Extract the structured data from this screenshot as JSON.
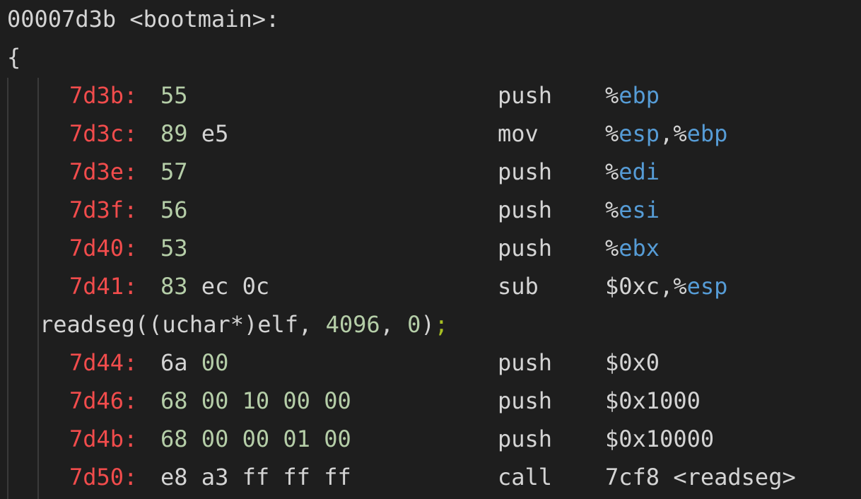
{
  "header": {
    "label": "00007d3b <bootmain>:",
    "brace": "{"
  },
  "instructions_a": [
    {
      "addr": "7d3b:",
      "bytes": [
        {
          "t": "55",
          "c": "g"
        }
      ],
      "mnemonic": "push",
      "operands": [
        {
          "t": "%",
          "c": "plain"
        },
        {
          "t": "ebp",
          "c": "reg"
        }
      ]
    },
    {
      "addr": "7d3c:",
      "bytes": [
        {
          "t": "89",
          "c": "g"
        },
        {
          "t": " e5",
          "c": "plain"
        }
      ],
      "mnemonic": "mov",
      "operands": [
        {
          "t": "%",
          "c": "plain"
        },
        {
          "t": "esp",
          "c": "reg"
        },
        {
          "t": ",%",
          "c": "plain"
        },
        {
          "t": "ebp",
          "c": "reg"
        }
      ]
    },
    {
      "addr": "7d3e:",
      "bytes": [
        {
          "t": "57",
          "c": "g"
        }
      ],
      "mnemonic": "push",
      "operands": [
        {
          "t": "%",
          "c": "plain"
        },
        {
          "t": "edi",
          "c": "reg"
        }
      ]
    },
    {
      "addr": "7d3f:",
      "bytes": [
        {
          "t": "56",
          "c": "g"
        }
      ],
      "mnemonic": "push",
      "operands": [
        {
          "t": "%",
          "c": "plain"
        },
        {
          "t": "esi",
          "c": "reg"
        }
      ]
    },
    {
      "addr": "7d40:",
      "bytes": [
        {
          "t": "53",
          "c": "g"
        }
      ],
      "mnemonic": "push",
      "operands": [
        {
          "t": "%",
          "c": "plain"
        },
        {
          "t": "ebx",
          "c": "reg"
        }
      ]
    },
    {
      "addr": "7d41:",
      "bytes": [
        {
          "t": "83",
          "c": "g"
        },
        {
          "t": " ec 0c",
          "c": "plain"
        }
      ],
      "mnemonic": "sub",
      "operands": [
        {
          "t": "$0xc,%",
          "c": "plain"
        },
        {
          "t": "esp",
          "c": "reg"
        }
      ]
    }
  ],
  "source_line": [
    {
      "t": "readseg((uchar*)elf, ",
      "c": "plain"
    },
    {
      "t": "4096",
      "c": "num"
    },
    {
      "t": ", ",
      "c": "plain"
    },
    {
      "t": "0",
      "c": "num"
    },
    {
      "t": ")",
      "c": "plain"
    },
    {
      "t": ";",
      "c": "semi"
    }
  ],
  "instructions_b": [
    {
      "addr": "7d44:",
      "bytes": [
        {
          "t": "6a ",
          "c": "plain"
        },
        {
          "t": "00",
          "c": "g"
        }
      ],
      "mnemonic": "push",
      "operands": [
        {
          "t": "$0x0",
          "c": "plain"
        }
      ]
    },
    {
      "addr": "7d46:",
      "bytes": [
        {
          "t": "68 00 10 00 00",
          "c": "g"
        }
      ],
      "mnemonic": "push",
      "operands": [
        {
          "t": "$0x1000",
          "c": "plain"
        }
      ]
    },
    {
      "addr": "7d4b:",
      "bytes": [
        {
          "t": "68 00 00 01 00",
          "c": "g"
        }
      ],
      "mnemonic": "push",
      "operands": [
        {
          "t": "$0x10000",
          "c": "plain"
        }
      ]
    },
    {
      "addr": "7d50:",
      "bytes": [
        {
          "t": "e8 a3 ff ff ff",
          "c": "plain"
        }
      ],
      "mnemonic": "call",
      "operands": [
        {
          "t": "7cf8 <readseg>",
          "c": "plain"
        }
      ]
    }
  ]
}
